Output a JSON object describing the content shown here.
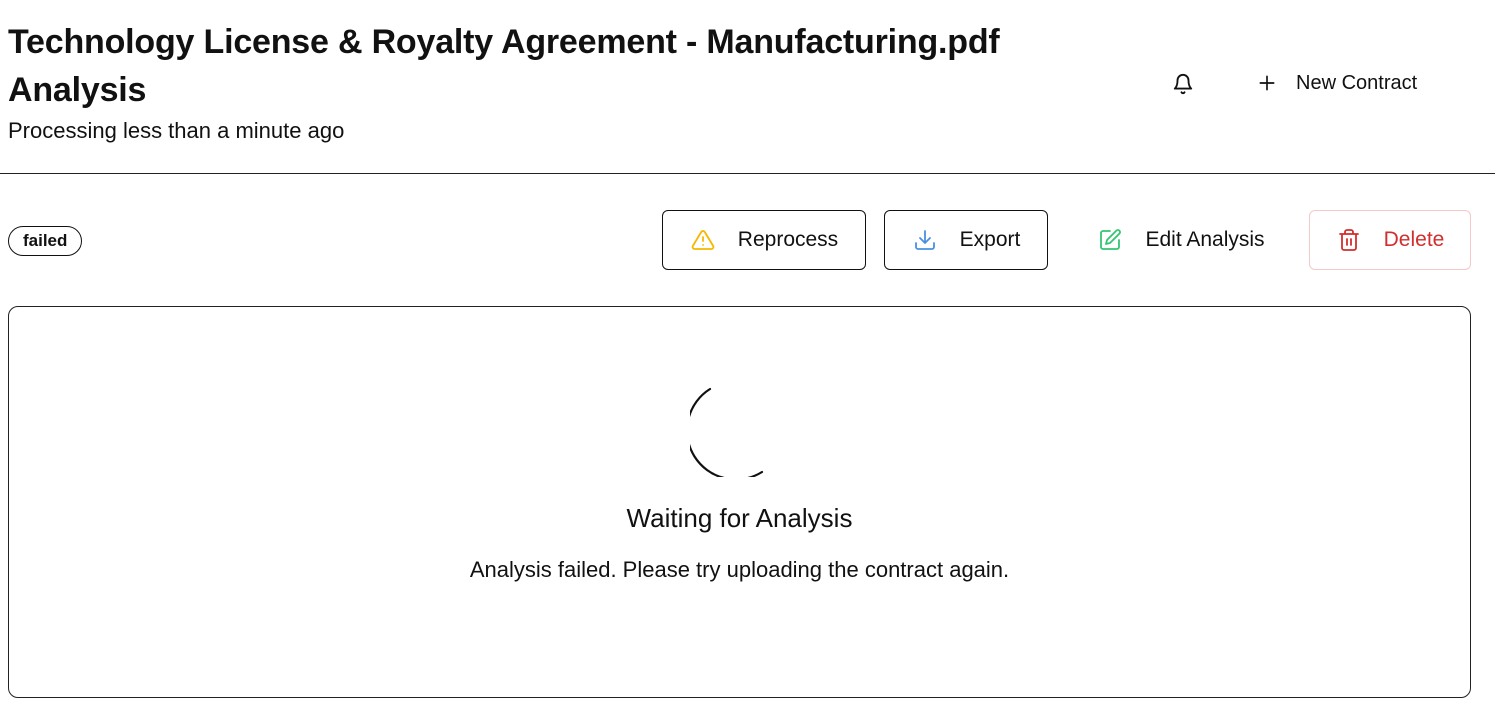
{
  "header": {
    "title": "Technology License & Royalty Agreement - Manufacturing.pdf Analysis",
    "subtitle": "Processing less than a minute ago",
    "notifications_icon": "bell-icon",
    "new_contract_label": "New Contract",
    "new_contract_icon": "plus-icon"
  },
  "toolbar": {
    "status": "failed",
    "reprocess_label": "Reprocess",
    "reprocess_icon": "warning-triangle-icon",
    "export_label": "Export",
    "export_icon": "download-icon",
    "edit_label": "Edit Analysis",
    "edit_icon": "edit-icon",
    "delete_label": "Delete",
    "delete_icon": "trash-icon"
  },
  "panel": {
    "title": "Waiting for Analysis",
    "message": "Analysis failed. Please try uploading the contract again."
  },
  "colors": {
    "warning": "#f5b800",
    "export": "#4a90e2",
    "edit": "#34c472",
    "danger": "#d12f2f",
    "danger_border": "#f4c9c9"
  }
}
